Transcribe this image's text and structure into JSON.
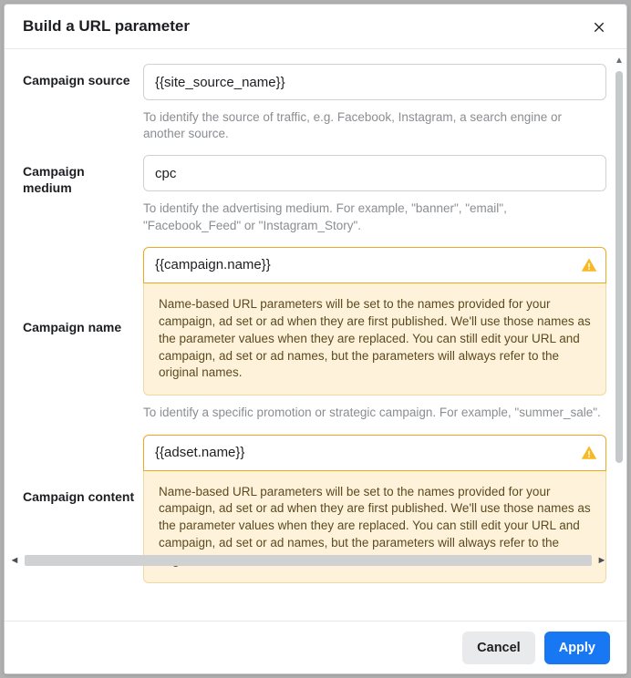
{
  "modal": {
    "title": "Build a URL parameter"
  },
  "fields": {
    "source": {
      "label": "Campaign source",
      "value": "{{site_source_name}}",
      "help": "To identify the source of traffic, e.g. Facebook, Instagram, a search engine or another source."
    },
    "medium": {
      "label": "Campaign medium",
      "value": "cpc",
      "help": "To identify the advertising medium. For example, \"banner\", \"email\", \"Facebook_Feed\" or \"Instagram_Story\"."
    },
    "name": {
      "label": "Campaign name",
      "value": "{{campaign.name}}",
      "warning": "Name-based URL parameters will be set to the names provided for your campaign, ad set or ad when they are first published. We'll use those names as the parameter values when they are replaced. You can still edit your URL and campaign, ad set or ad names, but the parameters will always refer to the original names.",
      "help": "To identify a specific promotion or strategic campaign. For example, \"summer_sale\"."
    },
    "content": {
      "label": "Campaign content",
      "value": "{{adset.name}}",
      "warning": "Name-based URL parameters will be set to the names provided for your campaign, ad set or ad when they are first published. We'll use those names as the parameter values when they are replaced. You can still edit your URL and campaign, ad set or ad names, but the parameters will always refer to the original names."
    }
  },
  "footer": {
    "cancel": "Cancel",
    "apply": "Apply"
  }
}
